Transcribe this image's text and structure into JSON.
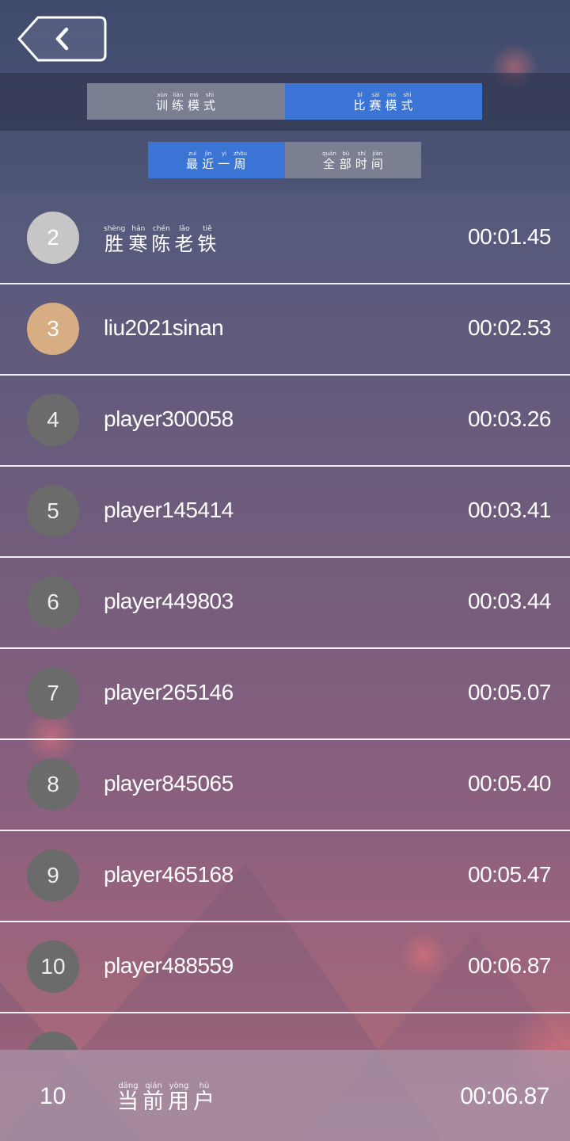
{
  "header": {
    "back_icon": "chevron-left-icon"
  },
  "mode_tabs": [
    {
      "chars": [
        {
          "py": "xùn",
          "hz": "训"
        },
        {
          "py": "liàn",
          "hz": "练"
        },
        {
          "py": "mó",
          "hz": "模"
        },
        {
          "py": "shì",
          "hz": "式"
        }
      ],
      "active": false
    },
    {
      "chars": [
        {
          "py": "bǐ",
          "hz": "比"
        },
        {
          "py": "sài",
          "hz": "赛"
        },
        {
          "py": "mó",
          "hz": "模"
        },
        {
          "py": "shì",
          "hz": "式"
        }
      ],
      "active": true
    }
  ],
  "period_tabs": [
    {
      "chars": [
        {
          "py": "zuì",
          "hz": "最"
        },
        {
          "py": "jìn",
          "hz": "近"
        },
        {
          "py": "yì",
          "hz": "一"
        },
        {
          "py": "zhōu",
          "hz": "周"
        }
      ],
      "active": true
    },
    {
      "chars": [
        {
          "py": "quán",
          "hz": "全"
        },
        {
          "py": "bù",
          "hz": "部"
        },
        {
          "py": "shí",
          "hz": "时"
        },
        {
          "py": "jiān",
          "hz": "间"
        }
      ],
      "active": false
    }
  ],
  "leaderboard": [
    {
      "rank": "2",
      "name_chars": [
        {
          "py": "shèng",
          "hz": "胜"
        },
        {
          "py": "hán",
          "hz": "寒"
        },
        {
          "py": "chén",
          "hz": "陈"
        },
        {
          "py": "lǎo",
          "hz": "老"
        },
        {
          "py": "tiě",
          "hz": "铁"
        }
      ],
      "time": "00:01.45",
      "medal": "silver"
    },
    {
      "rank": "3",
      "name": "liu2021sinan",
      "time": "00:02.53",
      "medal": "bronze"
    },
    {
      "rank": "4",
      "name": "player300058",
      "time": "00:03.26"
    },
    {
      "rank": "5",
      "name": "player145414",
      "time": "00:03.41"
    },
    {
      "rank": "6",
      "name": "player449803",
      "time": "00:03.44"
    },
    {
      "rank": "7",
      "name": "player265146",
      "time": "00:05.07"
    },
    {
      "rank": "8",
      "name": "player845065",
      "time": "00:05.40"
    },
    {
      "rank": "9",
      "name": "player465168",
      "time": "00:05.47"
    },
    {
      "rank": "10",
      "name": "player488559",
      "time": "00:06.87"
    }
  ],
  "current_user": {
    "rank": "10",
    "name_chars": [
      {
        "py": "dāng",
        "hz": "当"
      },
      {
        "py": "qián",
        "hz": "前"
      },
      {
        "py": "yòng",
        "hz": "用"
      },
      {
        "py": "hù",
        "hz": "户"
      }
    ],
    "time": "00:06.87"
  },
  "colors": {
    "tab_active": "#3a74d4",
    "tab_inactive": "#7a7f92",
    "silver": "#c6c6c6",
    "bronze": "#d7ad84",
    "rank_default": "#6b6b6b"
  }
}
